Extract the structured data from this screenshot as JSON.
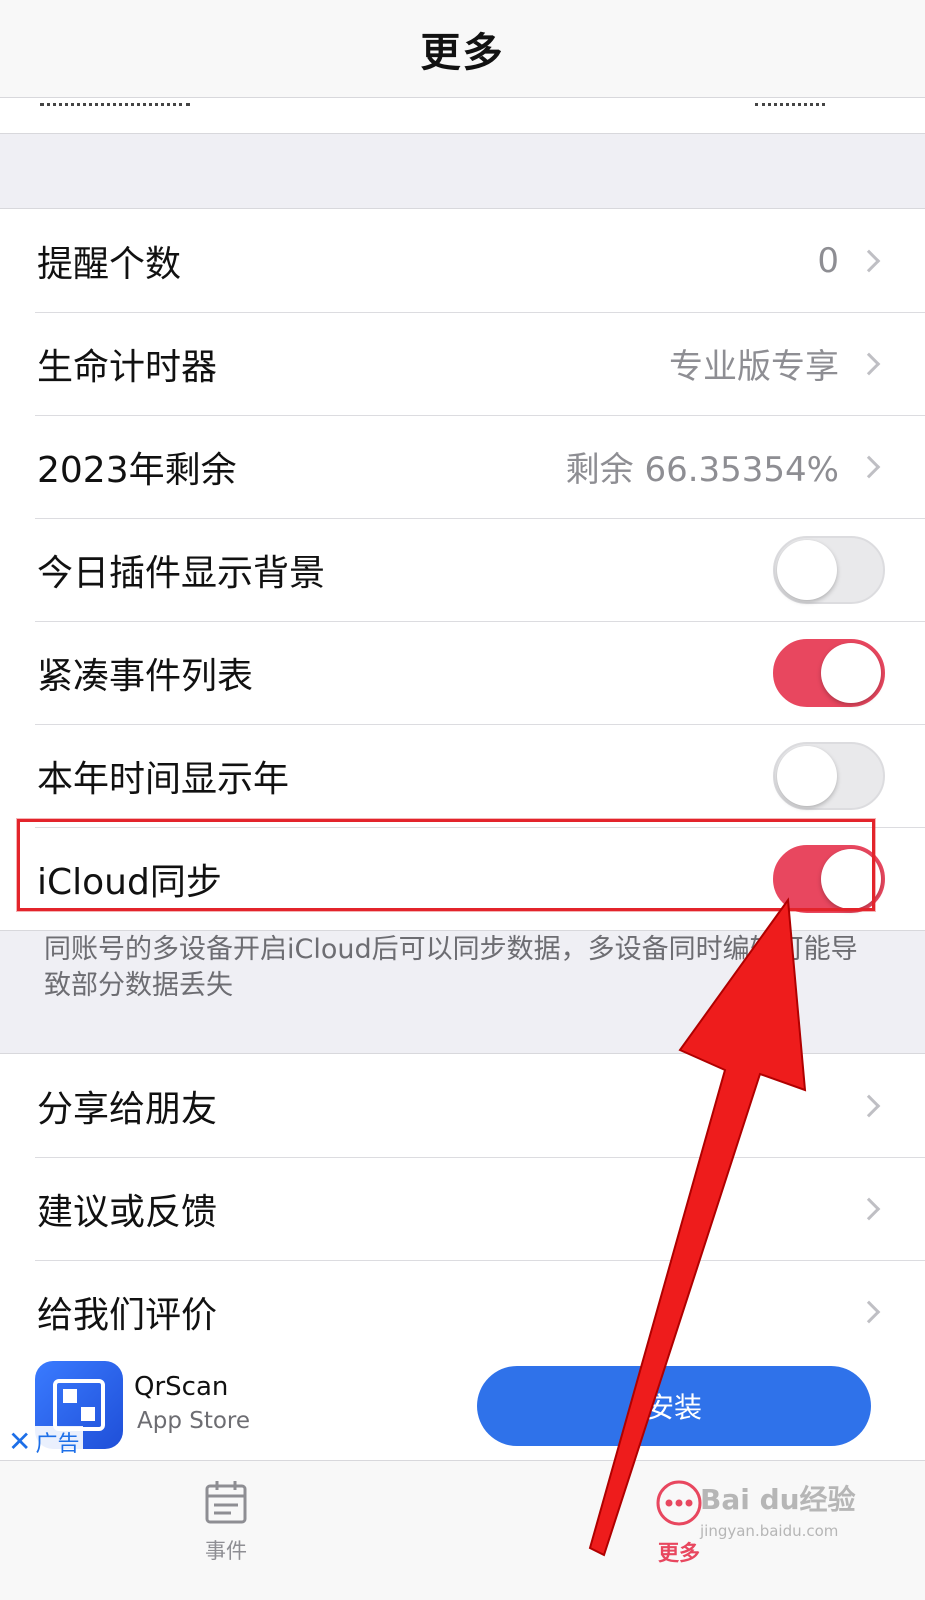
{
  "navbar": {
    "title": "更多"
  },
  "settings": {
    "rows": [
      {
        "label": "提醒个数",
        "value": "0",
        "kind": "link"
      },
      {
        "label": "生命计时器",
        "value": "专业版专享",
        "kind": "link"
      },
      {
        "label": "2023年剩余",
        "value": "剩余 66.35354%",
        "kind": "link"
      },
      {
        "label": "今日插件显示背景",
        "kind": "toggle",
        "on": false
      },
      {
        "label": "紧凑事件列表",
        "kind": "toggle",
        "on": true
      },
      {
        "label": "本年时间显示年",
        "kind": "toggle",
        "on": false
      },
      {
        "label": "iCloud同步",
        "kind": "toggle",
        "on": true
      }
    ],
    "footnote": "同账号的多设备开启iCloud后可以同步数据，多设备同时编辑可能导致部分数据丢失"
  },
  "links": {
    "rows": [
      {
        "label": "分享给朋友"
      },
      {
        "label": "建议或反馈"
      },
      {
        "label": "给我们评价"
      }
    ]
  },
  "ad": {
    "app_name": "QrScan",
    "store": "App Store",
    "close_label": "广告",
    "install_label": "安装"
  },
  "tabbar": {
    "events_label": "事件",
    "more_label": "更多"
  },
  "watermark": {
    "brand": "Bai du经验",
    "url": "jingyan.baidu.com"
  },
  "colors": {
    "accent": "#e8475f",
    "install_blue": "#2f72ea",
    "annotation_red": "#e3242b"
  }
}
